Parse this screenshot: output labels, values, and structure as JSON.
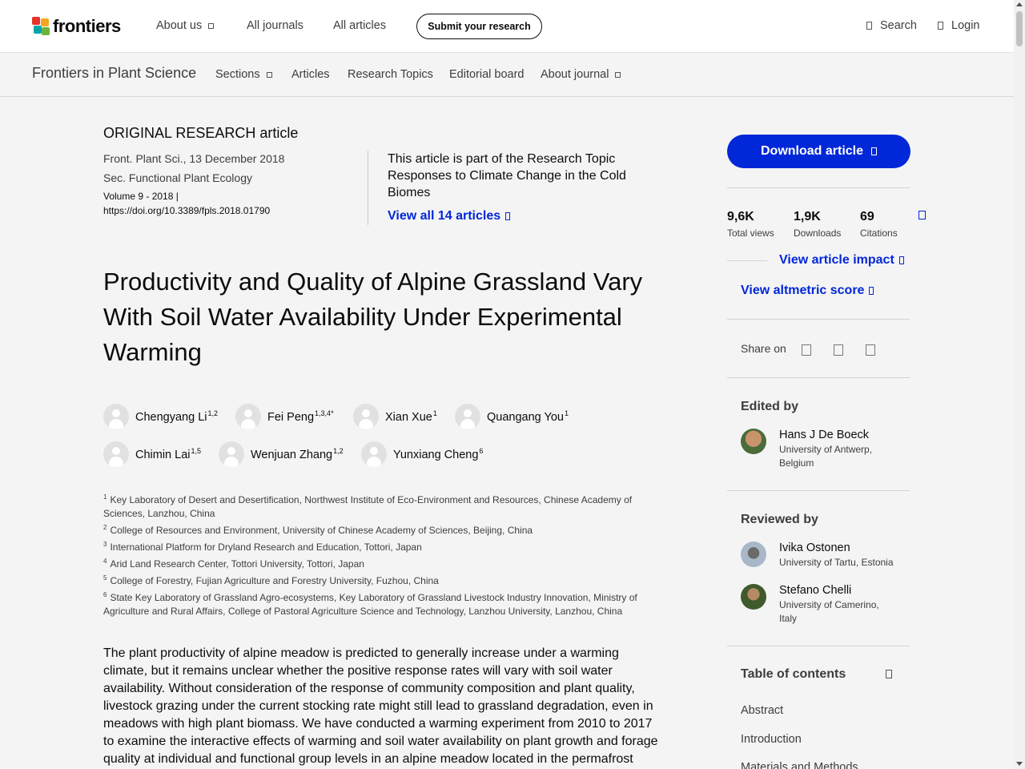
{
  "top_nav": {
    "logo_text": "frontiers",
    "items": [
      "About us",
      "All journals",
      "All articles"
    ],
    "submit_label": "Submit your research",
    "search_label": "Search",
    "login_label": "Login"
  },
  "journal_nav": {
    "journal_name": "Frontiers in Plant Science",
    "items": [
      "Sections",
      "Articles",
      "Research Topics",
      "Editorial board",
      "About journal"
    ]
  },
  "article": {
    "type_label": "ORIGINAL RESEARCH article",
    "journal_date": "Front. Plant Sci., 13 December 2018",
    "section": "Sec. Functional Plant Ecology",
    "volume": "Volume 9 - 2018 |",
    "doi": "https://doi.org/10.3389/fpls.2018.01790",
    "topic_text": "This article is part of the Research Topic Responses to Climate Change in the Cold Biomes",
    "topic_link": "View all 14 articles",
    "title": "Productivity and Quality of Alpine Grassland Vary With Soil Water Availability Under Experimental Warming",
    "authors": [
      {
        "name": "Chengyang Li",
        "sup": "1,2"
      },
      {
        "name": "Fei Peng",
        "sup": "1,3,4*"
      },
      {
        "name": "Xian Xue",
        "sup": "1"
      },
      {
        "name": "Quangang You",
        "sup": "1"
      },
      {
        "name": "Chimin Lai",
        "sup": "1,5"
      },
      {
        "name": "Wenjuan Zhang",
        "sup": "1,2"
      },
      {
        "name": "Yunxiang Cheng",
        "sup": "6"
      }
    ],
    "affiliations": [
      {
        "num": "1",
        "text": "Key Laboratory of Desert and Desertification, Northwest Institute of Eco-Environment and Resources, Chinese Academy of Sciences, Lanzhou, China"
      },
      {
        "num": "2",
        "text": "College of Resources and Environment, University of Chinese Academy of Sciences, Beijing, China"
      },
      {
        "num": "3",
        "text": "International Platform for Dryland Research and Education, Tottori, Japan"
      },
      {
        "num": "4",
        "text": "Arid Land Research Center, Tottori University, Tottori, Japan"
      },
      {
        "num": "5",
        "text": "College of Forestry, Fujian Agriculture and Forestry University, Fuzhou, China"
      },
      {
        "num": "6",
        "text": "State Key Laboratory of Grassland Agro-ecosystems, Key Laboratory of Grassland Livestock Industry Innovation, Ministry of Agriculture and Rural Affairs, College of Pastoral Agriculture Science and Technology, Lanzhou University, Lanzhou, China"
      }
    ],
    "abstract": "The plant productivity of alpine meadow is predicted to generally increase under a warming climate, but it remains unclear whether the positive response rates will vary with soil water availability. Without consideration of the response of community composition and plant quality, livestock grazing under the current stocking rate might still lead to grassland degradation, even in meadows with high plant biomass. We have conducted a warming experiment from 2010 to 2017 to examine the interactive effects of warming and soil water availability on plant growth and forage quality at individual and functional group levels in an alpine meadow located in the permafrost"
  },
  "sidebar": {
    "download_label": "Download article",
    "stats": [
      {
        "value": "9,6K",
        "label": "Total views"
      },
      {
        "value": "1,9K",
        "label": "Downloads"
      },
      {
        "value": "69",
        "label": "Citations"
      }
    ],
    "impact_link": "View article impact",
    "altmetric_link": "View altmetric score",
    "share_label": "Share on",
    "edited_heading": "Edited by",
    "editor": {
      "name": "Hans J De Boeck",
      "affiliation": "University of Antwerp, Belgium"
    },
    "reviewed_heading": "Reviewed by",
    "reviewers": [
      {
        "name": "Ivika Ostonen",
        "affiliation": "University of Tartu, Estonia"
      },
      {
        "name": "Stefano Chelli",
        "affiliation": "University of Camerino, Italy"
      }
    ],
    "toc_heading": "Table of contents",
    "toc_items": [
      "Abstract",
      "Introduction",
      "Materials and Methods"
    ]
  },
  "colors": {
    "accent_blue": "#0027d8",
    "background": "#f4f4f4",
    "text": "#0c0c0c"
  }
}
